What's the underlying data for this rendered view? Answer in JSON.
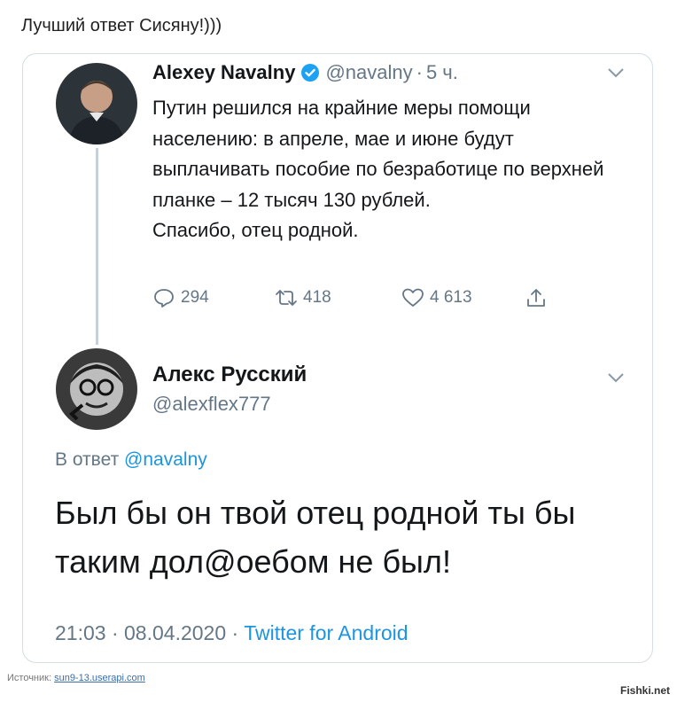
{
  "post_title": "Лучший ответ Сисяну!)))",
  "tweet": {
    "name": "Alexey Navalny",
    "handle": "@navalny",
    "separator": "·",
    "time": "5 ч.",
    "text": "Путин решился на крайние меры помощи населению: в апреле, мае и июне будут выплачивать пособие по безработице по верхней планке – 12 тысяч 130 рублей.\nСпасибо, отец родной.",
    "replies": "294",
    "retweets": "418",
    "likes": "4 613"
  },
  "reply": {
    "name": "Алекс Русский",
    "handle": "@alexflex777",
    "reply_to_label": "В ответ",
    "reply_to_mention": "@navalny",
    "text": "Был бы он твой отец родной ты бы таким дол@оебом не был!",
    "time": "21:03",
    "sep1": "·",
    "date": "08.04.2020",
    "sep2": "·",
    "client": "Twitter for Android"
  },
  "footer": {
    "source_label": "Источник:",
    "source_link": "sun9-13.userapi.com",
    "watermark": "Fishki.net"
  },
  "colors": {
    "accent": "#1b95e0",
    "secondary_text": "#657786",
    "verified": "#1da1f2"
  },
  "icons": [
    "verified-badge-icon",
    "chevron-down-icon",
    "reply-icon",
    "retweet-icon",
    "like-icon",
    "share-icon"
  ]
}
